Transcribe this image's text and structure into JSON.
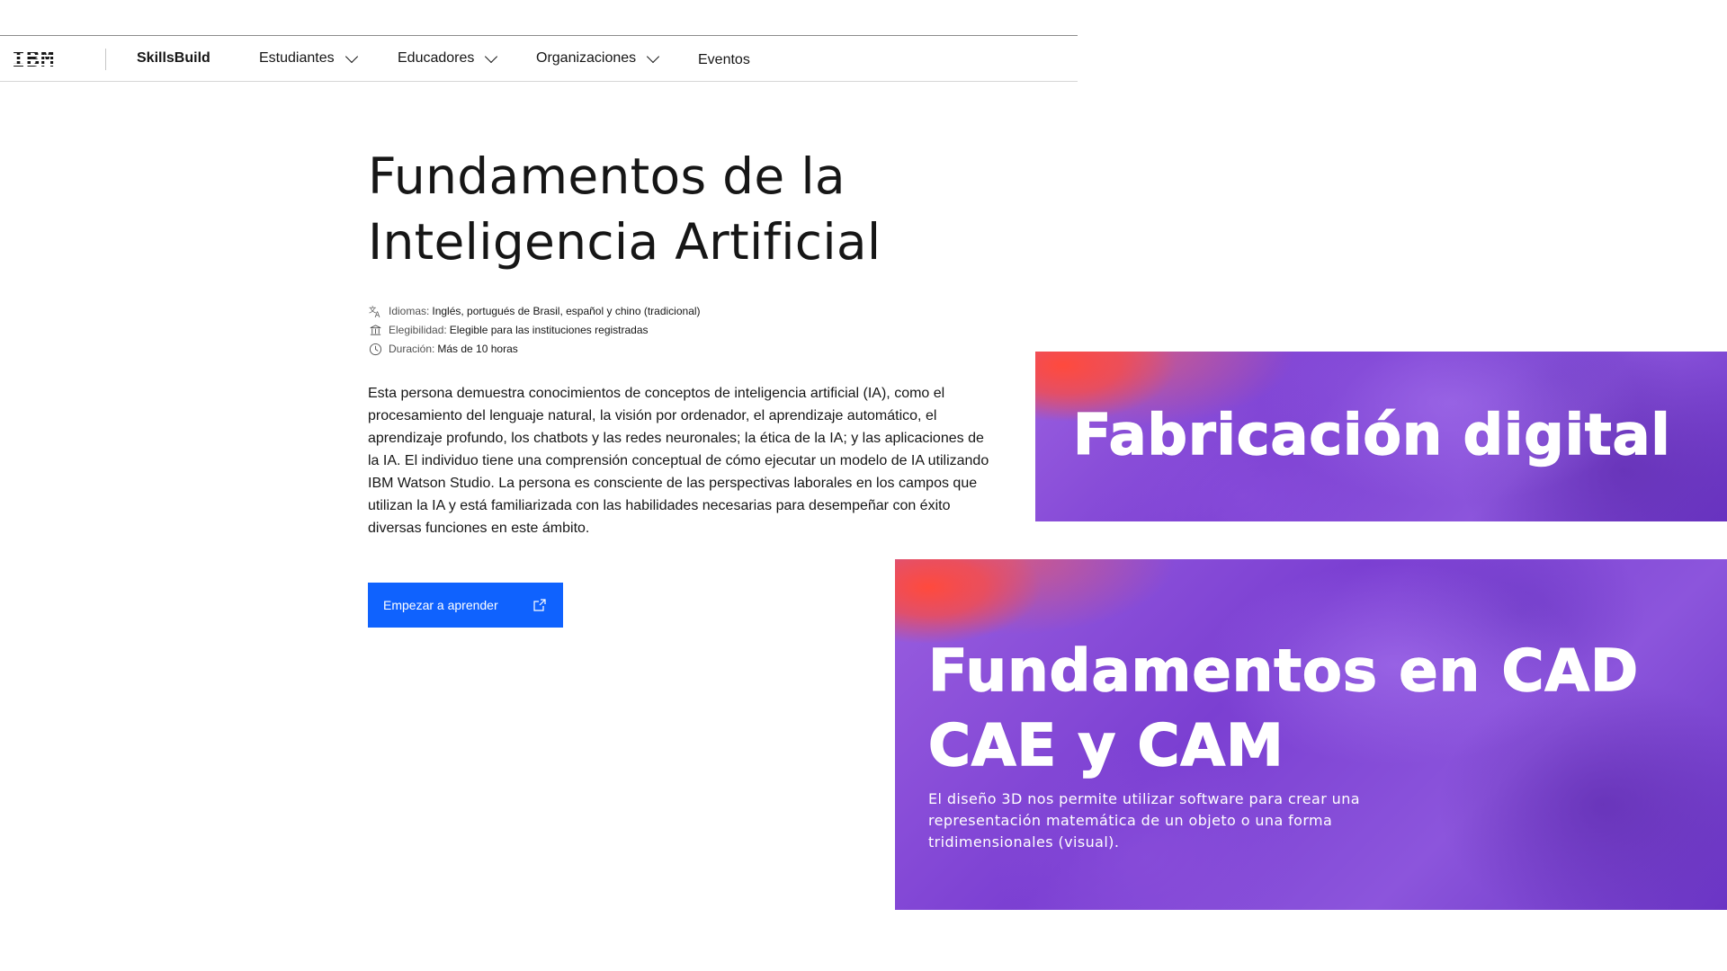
{
  "nav": {
    "logo": "IBM",
    "brand": "SkillsBuild",
    "items": [
      {
        "label": "Estudiantes",
        "has_dropdown": true
      },
      {
        "label": "Educadores",
        "has_dropdown": true
      },
      {
        "label": "Organizaciones",
        "has_dropdown": true
      },
      {
        "label": "Eventos",
        "has_dropdown": false
      }
    ]
  },
  "course": {
    "title_line1": "Fundamentos de la",
    "title_line2": "Inteligencia Artificial",
    "meta": {
      "languages": {
        "icon": "translate-icon",
        "key": "Idiomas:",
        "value": "Inglés, portugués de Brasil, español y chino (tradicional)"
      },
      "eligibility": {
        "icon": "institution-icon",
        "key": "Elegibilidad:",
        "value": "Elegible para las instituciones registradas"
      },
      "duration": {
        "icon": "clock-icon",
        "key": "Duración:",
        "value": "Más de 10 horas"
      }
    },
    "description": "Esta persona demuestra conocimientos de conceptos de inteligencia artificial (IA), como el procesamiento del lenguaje natural, la visión por ordenador, el aprendizaje automático, el aprendizaje profundo, los chatbots y las redes neuronales; la ética de la IA; y las aplicaciones de la IA. El individuo tiene una comprensión conceptual de cómo ejecutar un modelo de IA utilizando IBM Watson Studio. La persona es consciente de las perspectivas laborales en los campos que utilizan la IA y está familiarizada con las habilidades necesarias para desempeñar con éxito diversas funciones en este ámbito.",
    "cta_label": "Empezar a aprender",
    "cta_icon": "external-link-icon"
  },
  "banners": {
    "first": {
      "title": "Fabricación digital"
    },
    "second": {
      "title_line1": "Fundamentos en CAD",
      "title_line2": "CAE y CAM",
      "subtitle": "El diseño 3D nos permite utilizar software para crear una representación matemática de un objeto o una forma tridimensionales (visual)."
    }
  },
  "colors": {
    "primary_button": "#0f62fe",
    "text": "#161616",
    "banner_purple": "#7b3fd2",
    "banner_red": "#ff4a3d"
  }
}
